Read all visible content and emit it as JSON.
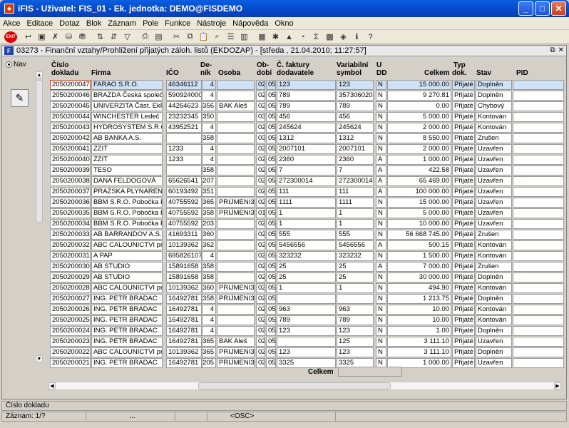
{
  "window": {
    "title": "iFIS - Uživatel: FIS_01 - Ek. jednotka: DEMO@FISDEMO"
  },
  "menu": [
    "Akce",
    "Editace",
    "Dotaz",
    "Blok",
    "Záznam",
    "Pole",
    "Funkce",
    "Nástroje",
    "Nápověda",
    "Okno"
  ],
  "toolbar": {
    "exit_label": "EXIT"
  },
  "form": {
    "title": "03273 - Finanční vztahy/Prohlížení přijatých záloh. listů (EKDOZAP) - [středa , 21.04.2010; 11:27:57]",
    "nav_label": "Nav"
  },
  "columns": {
    "cislo": "Číslo\ndokladu",
    "firma": "Firma",
    "ico": "IČO",
    "denik": "De-\nník",
    "osoba": "Osoba",
    "obdobi": "Ob-\ndobí",
    "cfaktury": "Č. faktury\ndodavatele",
    "vs": "Variabilní\nsymbol",
    "udd": "U\nDD",
    "celkem": "Celkem",
    "typ": "Typ\ndok.",
    "stav": "Stav",
    "pid": "PID"
  },
  "rows": [
    [
      "2050200047",
      "FARAO S.R.O.",
      "46346112",
      "4",
      "",
      "02",
      "05",
      "123",
      "123",
      "N",
      "15 000.00",
      "Přijaté zá",
      "Doplněn"
    ],
    [
      "2050200046",
      "BRAZDA Česká společno",
      "5909240007",
      "4",
      "",
      "02",
      "05",
      "789",
      "3573060204",
      "N",
      "9 270.81",
      "Přijaté zá",
      "Doplněn"
    ],
    [
      "2050200045",
      "UNIVERZITA Část. EkF",
      "44264623",
      "356",
      "BAK Aleš",
      "02",
      "05",
      "789",
      "789",
      "N",
      "0.00",
      "Přijaté zá",
      "Chybový"
    ],
    [
      "2050200044",
      "WINCHESTER Ledeč",
      "23232345",
      "350",
      "",
      "03",
      "05",
      "456",
      "456",
      "N",
      "5 000.00",
      "Přijaté zá",
      "Kontován"
    ],
    [
      "2050200043",
      "HYDROSYSTEM S.R.O.",
      "43952521",
      "4",
      "",
      "02",
      "05",
      "245624",
      "245624",
      "N",
      "2 000.00",
      "Přijaté zá",
      "Kontován"
    ],
    [
      "2050200042",
      "AB BANKA A.S.",
      "",
      "358",
      "",
      "03",
      "05",
      "1312",
      "1312",
      "N",
      "8 550.00",
      "Přijaté zá",
      "Zrušen"
    ],
    [
      "2050200041",
      "ZZIT",
      "1233",
      "4",
      "",
      "02",
      "05",
      "2007101",
      "2007101",
      "N",
      "2 000.00",
      "Přijaté zá",
      "Uzavřen"
    ],
    [
      "2050200040",
      "ZZIT",
      "1233",
      "4",
      "",
      "02",
      "05",
      "2360",
      "2360",
      "A",
      "1 000.00",
      "Přijaté zá",
      "Uzavřen"
    ],
    [
      "2050200039",
      " TESO",
      "",
      "358",
      "",
      "02",
      "05",
      "7",
      "7",
      "A",
      "422.58",
      "Přijaté zá",
      "Uzavřen"
    ],
    [
      "2050200038",
      "DANA FELDOGOVÁ",
      "65626541",
      "207",
      "",
      "02",
      "05",
      "272300014",
      "272300014",
      "A",
      "65 469.00",
      "Přijaté zá",
      "Uzavřen"
    ],
    [
      "2050200037",
      "PRAZSKA PLYNARENSK",
      "60193492",
      "351",
      "",
      "02",
      "05",
      "111",
      "111",
      "A",
      "100 000.00",
      "Přijaté zá",
      "Uzavřen"
    ],
    [
      "2050200036",
      "BBM S.R.O. Pobočka Prah",
      "40755592",
      "365",
      "PRIJMENI3547",
      "02",
      "05",
      "1111",
      "1111",
      "N",
      "15 000.00",
      "Přijaté zá",
      "Uzavřen"
    ],
    [
      "2050200035",
      "BBM S.R.O. Pobočka Prah",
      "40755592",
      "358",
      "PRIJMENI3547",
      "01",
      "05",
      "1",
      "1",
      "N",
      "5 000.00",
      "Přijaté zá",
      "Uzavřen"
    ],
    [
      "2050200034",
      "BBM S.R.O. Pobočka Prah",
      "40755592",
      "203",
      "",
      "02",
      "05",
      "1",
      "1",
      "N",
      "10 000.00",
      "Přijaté zá",
      "Uzavřen"
    ],
    [
      "2050200033",
      "AB BARRANDOV A.S.",
      "41693311",
      "360",
      "",
      "02",
      "05",
      "555",
      "555",
      "N",
      "56 668 745.00",
      "Přijaté zá",
      "Zrušen"
    ],
    [
      "2050200032",
      "ABC CALOUNICTVI provo",
      "10139362",
      "362",
      "",
      "02",
      "05",
      "5456556",
      "5456556",
      "A",
      "500.15",
      "Přijaté zá",
      "Kontován"
    ],
    [
      "2050200031",
      "A PAP",
      "6958261078",
      "4",
      "",
      "02",
      "05",
      "323232",
      "323232",
      "N",
      "1 500.00",
      "Přijaté zá",
      "Kontován"
    ],
    [
      "2050200030",
      "AB STUDIO",
      "15891658",
      "358",
      "",
      "02",
      "05",
      "25",
      "25",
      "A",
      "7 000.00",
      "Přijaté zá",
      "Zrušen"
    ],
    [
      "2050200029",
      "AB STUDIO",
      "15891658",
      "358",
      "",
      "02",
      "05",
      "25",
      "25",
      "N",
      "30 000.00",
      "Přijaté zá",
      "Doplněn"
    ],
    [
      "2050200028",
      "ABC CALOUNICTVI provo",
      "10139362",
      "360",
      "PRIJMENI3547",
      "02",
      "05",
      "1",
      "1",
      "N",
      "494.90",
      "Přijaté zá",
      "Kontován"
    ],
    [
      "2050200027",
      "ING. PETR BRADAC",
      "16492781",
      "358",
      "PRIJMENI3547",
      "02",
      "05",
      "",
      "",
      "N",
      "1 213.75",
      "Přijaté zá",
      "Doplněn"
    ],
    [
      "2050200026",
      "ING. PETR BRADAC",
      "16492781",
      "4",
      "",
      "02",
      "05",
      "963",
      "963",
      "N",
      "10.00",
      "Přijaté zá",
      "Kontován"
    ],
    [
      "2050200025",
      "ING. PETR BRADAC",
      "16492781",
      "4",
      "",
      "02",
      "05",
      "789",
      "789",
      "N",
      "10.00",
      "Přijaté zá",
      "Kontován"
    ],
    [
      "2050200024",
      "ING. PETR BRADAC",
      "16492781",
      "4",
      "",
      "02",
      "05",
      "123",
      "123",
      "N",
      "1.00",
      "Přijaté zá",
      "Doplněn"
    ],
    [
      "2050200023",
      "ING. PETR BRADAC",
      "16492781",
      "365",
      "BAK Aleš",
      "02",
      "05",
      "",
      "125",
      "N",
      "3 111.10",
      "Přijaté zá",
      "Uzavřen"
    ],
    [
      "2050200022",
      "ABC CALOUNICTVI provo",
      "10139362",
      "365",
      "PRIJMENI3547",
      "02",
      "05",
      "123",
      "123",
      "N",
      "3 111.10",
      "Přijaté zá",
      "Doplněn"
    ],
    [
      "2050200021",
      "ING. PETR BRADAC",
      "16492781",
      "205",
      "PRIJMENI3547",
      "02",
      "05",
      "3325",
      "3325",
      "N",
      "1 000.00",
      "Přijaté zá",
      "Uzavřen"
    ]
  ],
  "footer": {
    "celkem_label": "Celkem"
  },
  "status": {
    "field": "Číslo dokladu",
    "record": "Záznam: 1/?",
    "dots": "...",
    "osc": "<OSC>"
  }
}
